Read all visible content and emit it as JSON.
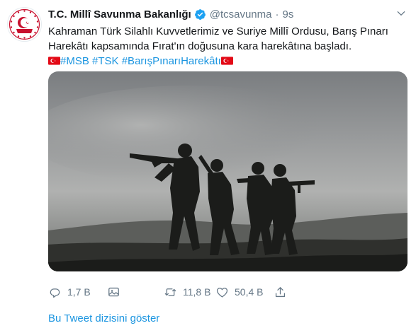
{
  "account": {
    "name": "T.C. Millî Savunma Bakanlığı",
    "handle": "@tcsavunma",
    "separator": "·",
    "time": "9s",
    "verified": true
  },
  "tweet": {
    "line1": "Kahraman Türk Silahlı Kuvvetlerimiz ve Suriye Millî Ordusu, Barış Pınarı",
    "line2": "Harekâtı kapsamında Fırat'ın doğusuna kara harekâtına başladı.",
    "hashtags": [
      "#MSB",
      "#TSK",
      "#BarışPınarıHarekâtı"
    ],
    "flag_emoji": "turkey-flag-icon"
  },
  "media": {
    "icon": "photo-soldiers-silhouette"
  },
  "actions": {
    "reply_count": "1,7 B",
    "retweet_count": "11,8 B",
    "like_count": "50,4 B"
  },
  "footer": {
    "show_thread": "Bu Tweet dizisini göster"
  },
  "colors": {
    "link": "#1b95e0",
    "secondary_text": "#657786",
    "verified": "#1da1f2",
    "flag_red": "#e30a17",
    "logo_red": "#c8102e"
  }
}
